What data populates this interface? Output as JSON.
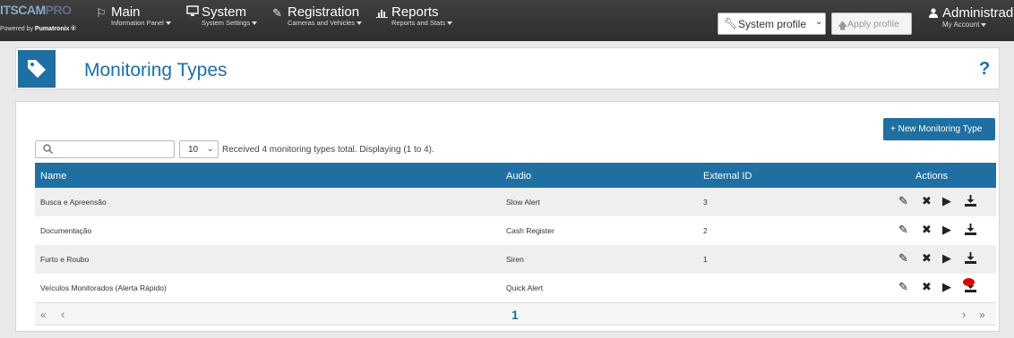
{
  "brand": {
    "logo_part1": "ITSCAM",
    "logo_part2": "PRO",
    "powered_prefix": "Powered by",
    "powered_name": "Pumatronix ®"
  },
  "nav": [
    {
      "icon": "flag-icon",
      "title": "Main",
      "subtitle": "Information Panel"
    },
    {
      "icon": "monitor-icon",
      "title": "System",
      "subtitle": "System Settings"
    },
    {
      "icon": "edit-icon",
      "title": "Registration",
      "subtitle": "Cameras and Vehicles"
    },
    {
      "icon": "bar-chart-icon",
      "title": "Reports",
      "subtitle": "Reports and Stats"
    }
  ],
  "profile": {
    "icon": "wrench-icon",
    "selected": "System profile"
  },
  "apply_profile": {
    "icon": "arrow-up-icon",
    "label": "Apply profile"
  },
  "account": {
    "icon": "user-icon",
    "name": "Administrador",
    "subtitle": "My Account"
  },
  "page": {
    "icon": "tag-icon",
    "title": "Monitoring Types",
    "help": "?"
  },
  "toolbar": {
    "new_button_label": "+ New Monitoring Type",
    "search_placeholder": "",
    "search_icon": "search-icon",
    "page_size": "10",
    "info": "Received 4 monitoring types total. Displaying (1 to 4)."
  },
  "table": {
    "columns": [
      "Name",
      "Audio",
      "External ID",
      "Actions"
    ],
    "rows": [
      {
        "name": "Busca e Apreensão",
        "audio": "Slow Alert",
        "external_id": "3"
      },
      {
        "name": "Documentação",
        "audio": "Cash Register",
        "external_id": "2"
      },
      {
        "name": "Furto e Roubo",
        "audio": "Siren",
        "external_id": "1"
      },
      {
        "name": "Veículos Monitorados (Alerta Rápido)",
        "audio": "Quick Alert",
        "external_id": ""
      }
    ],
    "action_icons": [
      "edit-icon",
      "delete-icon",
      "play-icon",
      "download-icon"
    ]
  },
  "pagination": {
    "first": "«",
    "prev": "‹",
    "current": "1",
    "next": "›",
    "last": "»"
  },
  "colors": {
    "primary": "#1f6fa3",
    "topbar": "#333333",
    "row_alt": "#efefef",
    "marker": "#e00000"
  }
}
